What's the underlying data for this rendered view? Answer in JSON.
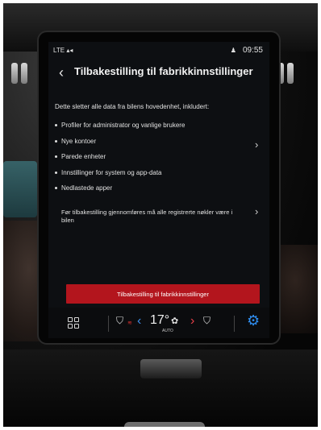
{
  "status_bar": {
    "network": "LTE",
    "time": "09:55"
  },
  "header": {
    "back_icon": "chevron-left-icon",
    "title": "Tilbakestilling til fabrikkinnstillinger"
  },
  "content": {
    "intro": "Dette sletter alle data fra bilens hovedenhet, inkludert:",
    "items": [
      "Profiler for administrator og vanlige brukere",
      "Nye kontoer",
      "Parede enheter",
      "Innstillinger for system og app-data",
      "Nedlastede apper"
    ],
    "note": "Før tilbakestilling gjennomføres må alle registrerte nøkler være i bilen"
  },
  "action": {
    "reset_label": "Tilbakestilling til fabrikkinnstillinger",
    "color": "#b3151d"
  },
  "climate": {
    "temperature": "17°",
    "mode": "AUTO",
    "accent_blue": "#3e8ee8",
    "accent_red": "#e8404a"
  }
}
